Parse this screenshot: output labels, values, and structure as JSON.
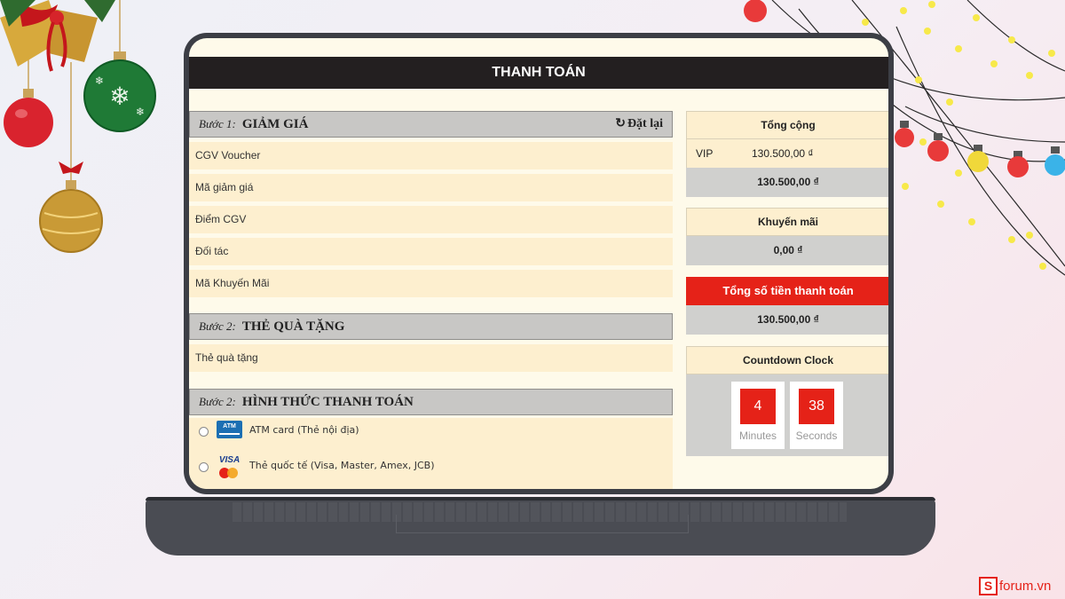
{
  "page_title": "THANH TOÁN",
  "step1": {
    "step": "Bước 1:",
    "heading": "GIẢM GIÁ",
    "reset_label": "Đặt lại",
    "items": [
      "CGV Voucher",
      "Mã giảm giá",
      "Điểm CGV",
      "Đối tác",
      "Mã Khuyến Mãi"
    ]
  },
  "step2": {
    "step": "Bước 2:",
    "heading": "THẺ QUÀ TẶNG",
    "items": [
      "Thẻ quà tặng"
    ]
  },
  "step3": {
    "step": "Bước 2:",
    "heading": "HÌNH THỨC THANH TOÁN",
    "options": [
      {
        "label": "ATM card (Thẻ nội địa)",
        "icon": "atm-card-icon",
        "logo_text": "ATM"
      },
      {
        "label": "Thẻ quốc tế (Visa, Master, Amex, JCB)",
        "icon": "visa-mastercard-icon",
        "logo_text": "VISA"
      }
    ]
  },
  "summary": {
    "total_heading": "Tổng cộng",
    "ticket_type": "VIP",
    "ticket_price": "130.500,00 ₫",
    "total_value": "130.500,00 ₫",
    "promo_heading": "Khuyến mãi",
    "promo_value": "0,00 ₫",
    "pay_heading": "Tổng số tiền thanh toán",
    "pay_value": "130.500,00 ₫"
  },
  "countdown": {
    "heading": "Countdown Clock",
    "minutes": "4",
    "minutes_label": "Minutes",
    "seconds": "38",
    "seconds_label": "Seconds"
  },
  "brand": {
    "letter": "S",
    "text": "forum.vn"
  },
  "colors": {
    "accent_red": "#e52218",
    "title_bar": "#231f20",
    "panel_beige": "#fdefcf",
    "panel_gray": "#d0d0ce"
  }
}
